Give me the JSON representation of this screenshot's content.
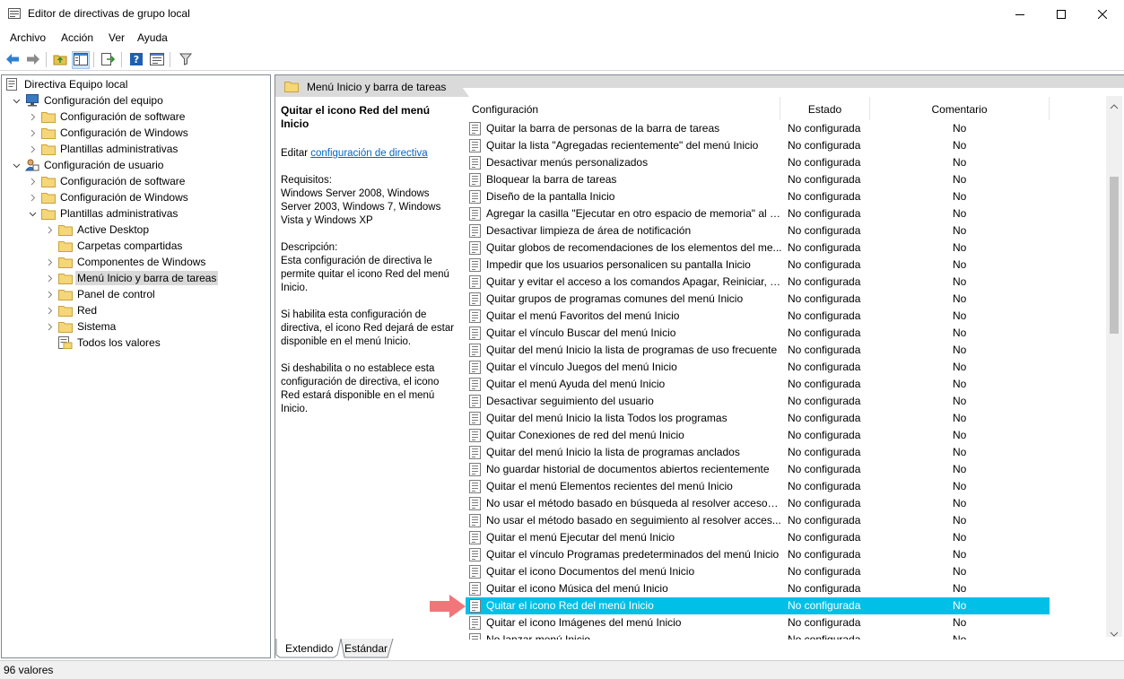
{
  "window": {
    "title": "Editor de directivas de grupo local",
    "minimize_glyph": "minimize-icon",
    "maximize_glyph": "maximize-icon",
    "close_glyph": "close-icon"
  },
  "menu": [
    "Archivo",
    "Acción",
    "Ver",
    "Ayuda"
  ],
  "toolbar": {
    "icons": [
      "back-icon",
      "forward-icon",
      "up-folder-icon",
      "show-hide-tree-icon",
      "export-list-icon",
      "help-icon",
      "properties-icon",
      "filter-icon"
    ]
  },
  "tree": {
    "items": [
      {
        "label": "Directiva Equipo local",
        "level": 0,
        "icon": "policy-icon",
        "expander": "none"
      },
      {
        "label": "Configuración del equipo",
        "level": 1,
        "icon": "computer-icon",
        "expander": "expanded"
      },
      {
        "label": "Configuración de software",
        "level": 2,
        "icon": "folder-icon",
        "expander": "collapsed"
      },
      {
        "label": "Configuración de Windows",
        "level": 2,
        "icon": "folder-icon",
        "expander": "collapsed"
      },
      {
        "label": "Plantillas administrativas",
        "level": 2,
        "icon": "folder-icon",
        "expander": "collapsed"
      },
      {
        "label": "Configuración de usuario",
        "level": 1,
        "icon": "user-icon",
        "expander": "expanded"
      },
      {
        "label": "Configuración de software",
        "level": 2,
        "icon": "folder-icon",
        "expander": "collapsed"
      },
      {
        "label": "Configuración de Windows",
        "level": 2,
        "icon": "folder-icon",
        "expander": "collapsed"
      },
      {
        "label": "Plantillas administrativas",
        "level": 2,
        "icon": "folder-icon",
        "expander": "expanded"
      },
      {
        "label": "Active Desktop",
        "level": 3,
        "icon": "folder-icon",
        "expander": "collapsed"
      },
      {
        "label": "Carpetas compartidas",
        "level": 3,
        "icon": "folder-icon",
        "expander": "none"
      },
      {
        "label": "Componentes de Windows",
        "level": 3,
        "icon": "folder-icon",
        "expander": "collapsed"
      },
      {
        "label": "Menú Inicio y barra de tareas",
        "level": 3,
        "icon": "folder-icon",
        "expander": "collapsed",
        "selected": true
      },
      {
        "label": "Panel de control",
        "level": 3,
        "icon": "folder-icon",
        "expander": "collapsed"
      },
      {
        "label": "Red",
        "level": 3,
        "icon": "folder-icon",
        "expander": "collapsed"
      },
      {
        "label": "Sistema",
        "level": 3,
        "icon": "folder-icon",
        "expander": "collapsed"
      },
      {
        "label": "Todos los valores",
        "level": 3,
        "icon": "all-settings-icon",
        "expander": "none"
      }
    ]
  },
  "header": {
    "title": "Menú Inicio y barra de tareas"
  },
  "description": {
    "title": "Quitar el icono Red del menú Inicio",
    "edit_prefix": "Editar",
    "edit_link": "configuración de directiva",
    "requirements_label": "Requisitos:",
    "requirements": "Windows Server 2008, Windows Server 2003, Windows 7, Windows Vista y Windows XP",
    "description_label": "Descripción:",
    "description": "Esta configuración de directiva le permite quitar el icono Red del menú Inicio.",
    "enabled_text": "Si habilita esta configuración de directiva, el icono Red dejará de estar disponible en el menú Inicio.",
    "disabled_text": "Si deshabilita o no establece esta configuración de directiva, el icono Red estará disponible en el menú Inicio."
  },
  "columns": {
    "name": "Configuración",
    "state": "Estado",
    "comment": "Comentario"
  },
  "policies": [
    {
      "name": "Quitar la barra de personas de la barra de tareas",
      "state": "No configurada",
      "comment": "No"
    },
    {
      "name": "Quitar la lista \"Agregadas recientemente\" del menú Inicio",
      "state": "No configurada",
      "comment": "No"
    },
    {
      "name": "Desactivar menús personalizados",
      "state": "No configurada",
      "comment": "No"
    },
    {
      "name": "Bloquear la barra de tareas",
      "state": "No configurada",
      "comment": "No"
    },
    {
      "name": "Diseño de la pantalla Inicio",
      "state": "No configurada",
      "comment": "No"
    },
    {
      "name": "Agregar la casilla \"Ejecutar en otro espacio de memoria\" al c...",
      "state": "No configurada",
      "comment": "No"
    },
    {
      "name": "Desactivar limpieza de área de notificación",
      "state": "No configurada",
      "comment": "No"
    },
    {
      "name": "Quitar globos de recomendaciones de los elementos del me...",
      "state": "No configurada",
      "comment": "No"
    },
    {
      "name": "Impedir que los usuarios personalicen su pantalla Inicio",
      "state": "No configurada",
      "comment": "No"
    },
    {
      "name": "Quitar y evitar el acceso a los comandos Apagar, Reiniciar, S...",
      "state": "No configurada",
      "comment": "No"
    },
    {
      "name": "Quitar grupos de programas comunes del menú Inicio",
      "state": "No configurada",
      "comment": "No"
    },
    {
      "name": "Quitar el menú Favoritos del menú Inicio",
      "state": "No configurada",
      "comment": "No"
    },
    {
      "name": "Quitar el vínculo Buscar del menú Inicio",
      "state": "No configurada",
      "comment": "No"
    },
    {
      "name": "Quitar del menú Inicio la lista de programas de uso frecuente",
      "state": "No configurada",
      "comment": "No"
    },
    {
      "name": "Quitar el vínculo Juegos del menú Inicio",
      "state": "No configurada",
      "comment": "No"
    },
    {
      "name": "Quitar el menú Ayuda del menú Inicio",
      "state": "No configurada",
      "comment": "No"
    },
    {
      "name": "Desactivar seguimiento del usuario",
      "state": "No configurada",
      "comment": "No"
    },
    {
      "name": "Quitar del menú Inicio la lista Todos los programas",
      "state": "No configurada",
      "comment": "No"
    },
    {
      "name": "Quitar Conexiones de red del menú Inicio",
      "state": "No configurada",
      "comment": "No"
    },
    {
      "name": "Quitar del menú Inicio la lista de programas anclados",
      "state": "No configurada",
      "comment": "No"
    },
    {
      "name": "No guardar historial de documentos abiertos recientemente",
      "state": "No configurada",
      "comment": "No"
    },
    {
      "name": "Quitar el menú Elementos recientes del menú Inicio",
      "state": "No configurada",
      "comment": "No"
    },
    {
      "name": "No usar el método basado en búsqueda al resolver accesos ...",
      "state": "No configurada",
      "comment": "No"
    },
    {
      "name": "No usar el método basado en seguimiento al resolver acces...",
      "state": "No configurada",
      "comment": "No"
    },
    {
      "name": "Quitar el menú Ejecutar del menú Inicio",
      "state": "No configurada",
      "comment": "No"
    },
    {
      "name": "Quitar el vínculo Programas predeterminados del menú Inicio",
      "state": "No configurada",
      "comment": "No"
    },
    {
      "name": "Quitar el icono Documentos del menú Inicio",
      "state": "No configurada",
      "comment": "No"
    },
    {
      "name": "Quitar el icono Música del menú Inicio",
      "state": "No configurada",
      "comment": "No"
    },
    {
      "name": "Quitar el icono Red del menú Inicio",
      "state": "No configurada",
      "comment": "No",
      "selected": true
    },
    {
      "name": "Quitar el icono Imágenes del menú Inicio",
      "state": "No configurada",
      "comment": "No"
    },
    {
      "name": "No lanzar menú Inicio...",
      "state": "No configurada",
      "comment": "No"
    }
  ],
  "bottom_tabs": [
    "Extendido",
    "Estándar"
  ],
  "status": "96 valores",
  "colors": {
    "selection": "#00c0e8",
    "link": "#0066cc",
    "arrow": "#f2757a"
  }
}
